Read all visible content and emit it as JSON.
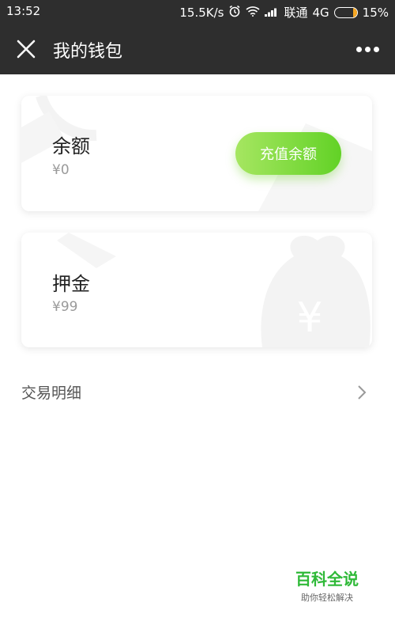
{
  "status_bar": {
    "time": "13:52",
    "network_speed": "15.5K/s",
    "carrier": "联通",
    "network_type": "4G",
    "battery": "15%",
    "battery_level": 0.15
  },
  "header": {
    "title": "我的钱包"
  },
  "balance_card": {
    "label": "余额",
    "amount": "¥0",
    "recharge_button": "充值余额"
  },
  "deposit_card": {
    "label": "押金",
    "amount": "¥99"
  },
  "transactions": {
    "label": "交易明细"
  },
  "watermark": {
    "title": "百科全说",
    "subtitle": "助你轻松解决"
  },
  "colors": {
    "header_bg": "#2e2e2e",
    "accent_green": "#62d226",
    "battery_orange": "#f5a623"
  }
}
